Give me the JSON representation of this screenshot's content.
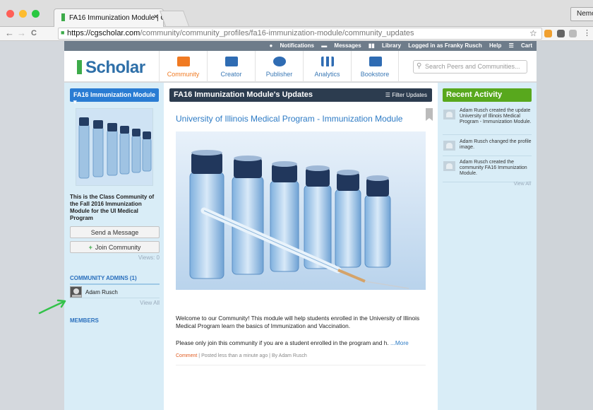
{
  "browser": {
    "tab_title": "FA16 Immunization Module | C",
    "tab_close": "×",
    "profile": "Nemo",
    "url_host": "https://cgscholar.com",
    "url_path": "/community/community_profiles/fa16-immunization-module/community_updates",
    "back": "←",
    "forward": "→",
    "reload": "C",
    "star": "☆",
    "traffic_colors": [
      "#ff5f57",
      "#febc2e",
      "#28c840"
    ]
  },
  "topbar": {
    "notifications": "Notifications",
    "messages": "Messages",
    "library": "Library",
    "logged_in": "Logged in as Franky Rusch",
    "help": "Help",
    "cart": "Cart"
  },
  "header": {
    "logo": "Scholar",
    "nav": [
      {
        "label": "Community",
        "icon": "community-icon",
        "color": "#f07a22"
      },
      {
        "label": "Creator",
        "icon": "creator-icon",
        "color": "#2f6cb3"
      },
      {
        "label": "Publisher",
        "icon": "publisher-icon",
        "color": "#2f6cb3"
      },
      {
        "label": "Analytics",
        "icon": "analytics-icon",
        "color": "#2f6cb3"
      },
      {
        "label": "Bookstore",
        "icon": "bookstore-icon",
        "color": "#2f6cb3"
      }
    ],
    "search_placeholder": "Search Peers and Communities..."
  },
  "left": {
    "community_button": "FA16 Immunization Module",
    "description": "This is the Class Community of the Fall 2016 Immunization Module for the UI Medical Program",
    "send_message": "Send a Message",
    "join_community": "Join Community",
    "views": "Views: 0",
    "admins_heading": "COMMUNITY ADMINS (1)",
    "admin_name": "Adam Rusch",
    "view_all": "View All",
    "members_heading": "MEMBERS"
  },
  "main": {
    "heading": "FA16 Immunization Module's Updates",
    "filter": "Filter Updates",
    "post_title": "University of Illinois Medical Program - Immunization Module",
    "post_text": "Welcome to our Community! This module will help students enrolled in the University of Illinois Medical Program learn the basics of Immunization and Vaccination.",
    "post_text2": "Please only join this community if you are a student enrolled in the program and h.",
    "more": "...More",
    "comment": "Comment",
    "posted": "Posted less than a minute ago",
    "by": "By Adam Rusch"
  },
  "right": {
    "heading": "Recent Activity",
    "activities": [
      "Adam Rusch created the update University of Illinois Medical Program - Immunization Module.",
      "Adam Rusch changed the profile image.",
      "Adam Rusch created the community FA16 Immunization Module."
    ],
    "view_all": "View All"
  }
}
